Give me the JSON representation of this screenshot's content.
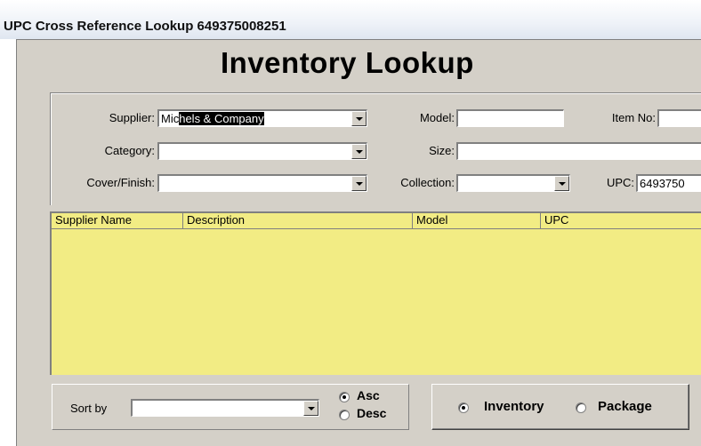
{
  "window": {
    "title": "UPC Cross Reference Lookup 649375008251"
  },
  "heading": "Inventory Lookup",
  "filters": {
    "supplier_label": "Supplier:",
    "supplier_value_plain": "Mic",
    "supplier_value_selected": "hels & Company",
    "category_label": "Category:",
    "category_value": "",
    "cover_label": "Cover/Finish:",
    "cover_value": "",
    "model_label": "Model:",
    "model_value": "",
    "size_label": "Size:",
    "size_value": "",
    "collection_label": "Collection:",
    "collection_value": "",
    "itemno_label": "Item No:",
    "itemno_value": "",
    "upc_label": "UPC:",
    "upc_value": "6493750"
  },
  "grid": {
    "columns": [
      "Supplier Name",
      "Description",
      "Model",
      "UPC"
    ],
    "rows": []
  },
  "sort": {
    "label": "Sort by",
    "value": "",
    "asc_label": "Asc",
    "desc_label": "Desc",
    "selected": "Asc"
  },
  "view": {
    "inventory_label": "Inventory",
    "package_label": "Package",
    "selected": "Inventory"
  },
  "colors": {
    "grid_background": "#f2ec84",
    "panel": "#d4d0c8",
    "selection": "#000000"
  }
}
